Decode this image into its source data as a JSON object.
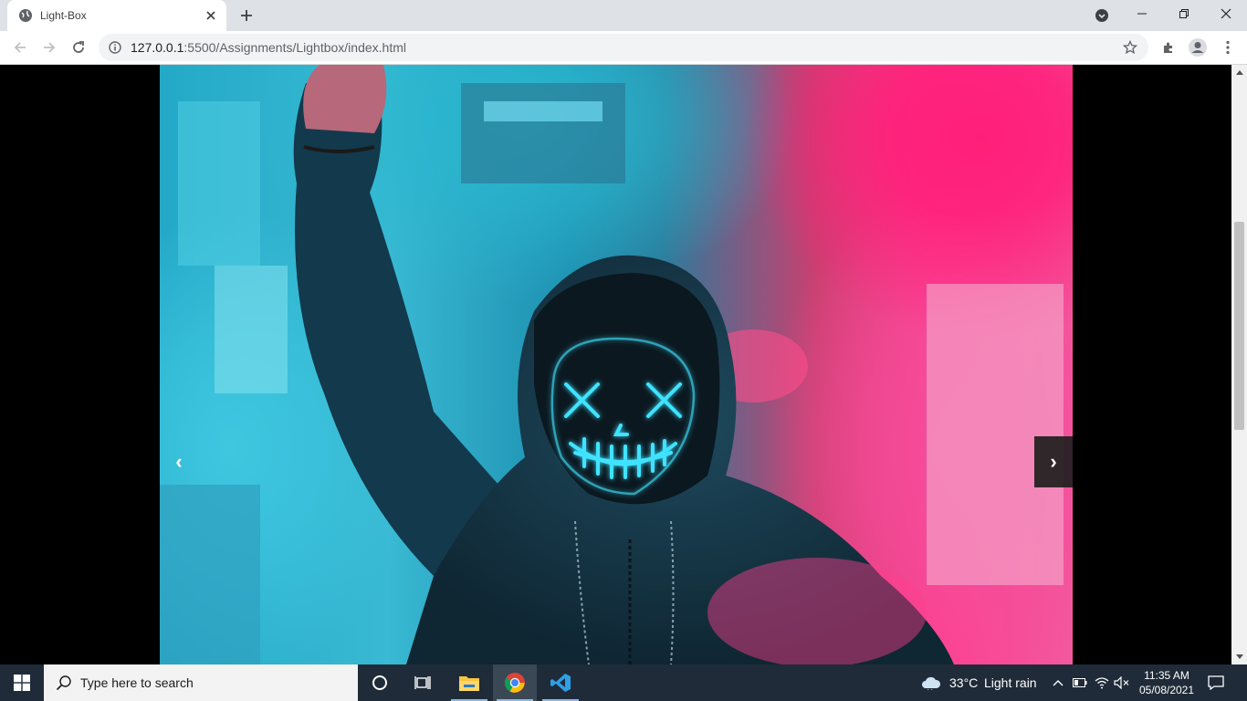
{
  "browser": {
    "tab": {
      "title": "Light-Box"
    },
    "address": {
      "host": "127.0.0.1",
      "rest": ":5500/Assignments/Lightbox/index.html"
    }
  },
  "lightbox": {
    "prev_label": "‹",
    "next_label": "›"
  },
  "taskbar": {
    "search_placeholder": "Type here to search",
    "weather": {
      "temp": "33°C",
      "condition": "Light rain"
    },
    "clock": {
      "time": "11:35 AM",
      "date": "05/08/2021"
    }
  },
  "colors": {
    "tabstrip": "#dee1e6",
    "taskbar": "#1f2b38",
    "neon_cyan": "#3fe3ff",
    "neon_pink": "#ff1f7a"
  }
}
